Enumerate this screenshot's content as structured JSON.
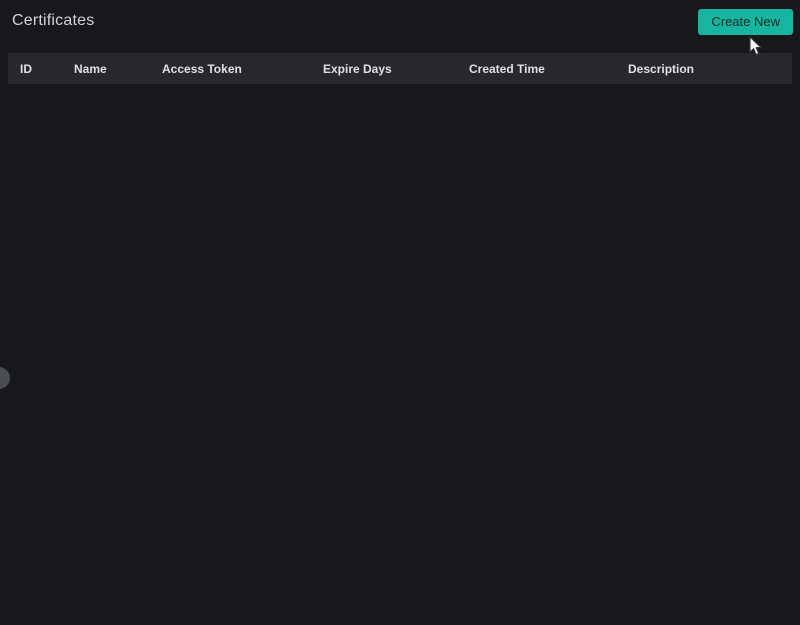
{
  "page": {
    "title": "Certificates"
  },
  "toolbar": {
    "create_button_label": "Create New"
  },
  "table": {
    "columns": [
      "ID",
      "Name",
      "Access Token",
      "Expire Days",
      "Created Time",
      "Description"
    ],
    "rows": []
  },
  "colors": {
    "accent_teal": "#16b5a0",
    "page_background": "#16181c",
    "header_row_background": "#26282b",
    "text": "#d6d8d9",
    "button_text": "#0e2b25"
  },
  "icons": {
    "cursor": "arrow-pointer",
    "drawer_handle": "semicircle-handle"
  }
}
